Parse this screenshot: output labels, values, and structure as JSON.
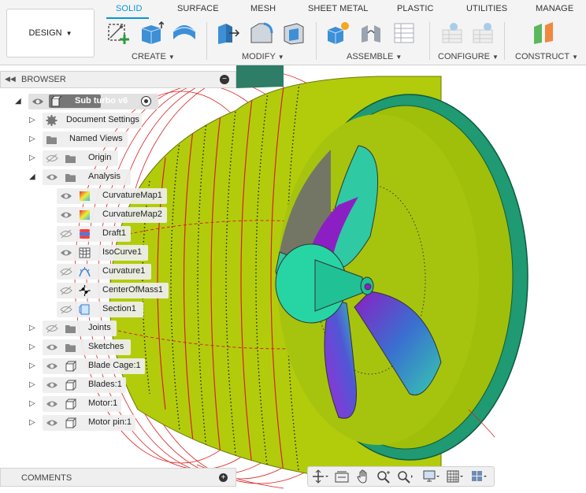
{
  "toolbar": {
    "design_label": "DESIGN",
    "tabs": [
      {
        "label": "SOLID",
        "active": true
      },
      {
        "label": "SURFACE",
        "active": false
      },
      {
        "label": "MESH",
        "active": false
      },
      {
        "label": "SHEET METAL",
        "active": false
      },
      {
        "label": "PLASTIC",
        "active": false
      },
      {
        "label": "UTILITIES",
        "active": false
      },
      {
        "label": "MANAGE",
        "active": false
      }
    ],
    "groups": {
      "create": "CREATE",
      "modify": "MODIFY",
      "assemble": "ASSEMBLE",
      "configure": "CONFIGURE",
      "construct": "CONSTRUCT"
    },
    "accent": "#0696d7"
  },
  "browser": {
    "title": "BROWSER",
    "root": "Sub turbo v6",
    "items": [
      {
        "label": "Document Settings",
        "icon": "gear-icon",
        "visibility": "none"
      },
      {
        "label": "Named Views",
        "icon": "folder-icon",
        "visibility": "none"
      },
      {
        "label": "Origin",
        "icon": "folder-icon",
        "visibility": "hidden"
      },
      {
        "label": "Analysis",
        "icon": "folder-icon",
        "visibility": "visible",
        "expanded": true
      },
      {
        "label": "CurvatureMap1",
        "icon": "curvature-map-icon",
        "visibility": "visible"
      },
      {
        "label": "CurvatureMap2",
        "icon": "curvature-map-icon",
        "visibility": "visible"
      },
      {
        "label": "Draft1",
        "icon": "draft-analysis-icon",
        "visibility": "hidden"
      },
      {
        "label": "IsoCurve1",
        "icon": "isocurve-icon",
        "visibility": "visible"
      },
      {
        "label": "Curvature1",
        "icon": "curvature-comb-icon",
        "visibility": "hidden"
      },
      {
        "label": "CenterOfMass1",
        "icon": "center-of-mass-icon",
        "visibility": "hidden"
      },
      {
        "label": "Section1",
        "icon": "section-analysis-icon",
        "visibility": "hidden"
      },
      {
        "label": "Joints",
        "icon": "folder-icon",
        "visibility": "hidden"
      },
      {
        "label": "Sketches",
        "icon": "folder-icon",
        "visibility": "visible"
      },
      {
        "label": "Blade Cage:1",
        "icon": "component-icon",
        "visibility": "visible"
      },
      {
        "label": "Blades:1",
        "icon": "component-icon",
        "visibility": "visible"
      },
      {
        "label": "Motor:1",
        "icon": "component-icon",
        "visibility": "visible"
      },
      {
        "label": "Motor pin:1",
        "icon": "component-icon",
        "visibility": "visible"
      }
    ]
  },
  "comments": {
    "title": "COMMENTS"
  },
  "nav_bar": {
    "icons": [
      "orbit-icon",
      "look-at-icon",
      "pan-icon",
      "zoom-icon",
      "fit-icon",
      "display-settings-icon",
      "grid-settings-icon",
      "viewports-icon"
    ]
  }
}
